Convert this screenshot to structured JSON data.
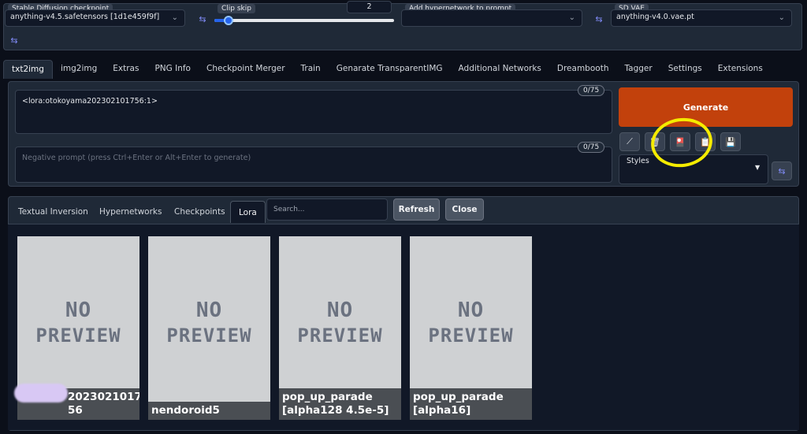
{
  "top": {
    "checkpoint_label": "Stable Diffusion checkpoint",
    "checkpoint_value": "anything-v4.5.safetensors [1d1e459f9f]",
    "clip_skip_label": "Clip skip",
    "clip_skip_value": "2",
    "clip_skip_fraction": 0.08,
    "hypernetwork_label": "Add hypernetwork to prompt",
    "hypernetwork_value": "",
    "vae_label": "SD VAE",
    "vae_value": "anything-v4.0.vae.pt"
  },
  "tabs": [
    "txt2img",
    "img2img",
    "Extras",
    "PNG Info",
    "Checkpoint Merger",
    "Train",
    "Genarate TransparentIMG",
    "Additional Networks",
    "Dreambooth",
    "Tagger",
    "Settings",
    "Extensions"
  ],
  "prompt": {
    "value": "<lora:otokoyama202302101756:1>",
    "counter": "0/75",
    "negative_placeholder": "Negative prompt (press Ctrl+Enter or Alt+Enter to generate)",
    "negative_counter": "0/75"
  },
  "generate_label": "Generate",
  "styles_label": "Styles",
  "tools": {
    "pencil": "⟋",
    "trash": "🗑",
    "card": "🎴",
    "clipboard": "📋",
    "save": "💾"
  },
  "extra": {
    "tabs": [
      "Textual Inversion",
      "Hypernetworks",
      "Checkpoints",
      "Lora"
    ],
    "search_placeholder": "Search...",
    "refresh": "Refresh",
    "close": "Close"
  },
  "cards": [
    {
      "preview_line1": "NO",
      "preview_line2": "PREVIEW",
      "caption": "2023021017\n56"
    },
    {
      "preview_line1": "NO",
      "preview_line2": "PREVIEW",
      "caption": "nendoroid5"
    },
    {
      "preview_line1": "NO",
      "preview_line2": "PREVIEW",
      "caption": "pop_up_parade [alpha128 4.5e-5]"
    },
    {
      "preview_line1": "NO",
      "preview_line2": "PREVIEW",
      "caption": "pop_up_parade [alpha16]"
    }
  ],
  "colors": {
    "accent_generate": "#c2410c",
    "highlight_circle": "#f5ec00"
  }
}
